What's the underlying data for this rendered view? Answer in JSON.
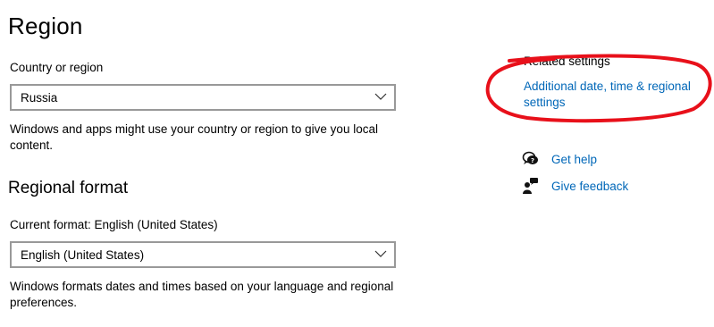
{
  "page": {
    "title": "Region"
  },
  "country": {
    "label": "Country or region",
    "selected": "Russia",
    "description": "Windows and apps might use your country or region to give you local content."
  },
  "regional_format": {
    "title": "Regional format",
    "current_label": "Current format: English (United States)",
    "selected": "English (United States)",
    "description": "Windows formats dates and times based on your language and regional preferences."
  },
  "related_settings": {
    "heading": "Related settings",
    "link": "Additional date, time & regional settings"
  },
  "help": {
    "get_help": "Get help",
    "give_feedback": "Give feedback"
  },
  "annotation": {
    "color": "#e8101a"
  },
  "colors": {
    "link": "#0067b8",
    "dropdown_border": "#999999"
  }
}
